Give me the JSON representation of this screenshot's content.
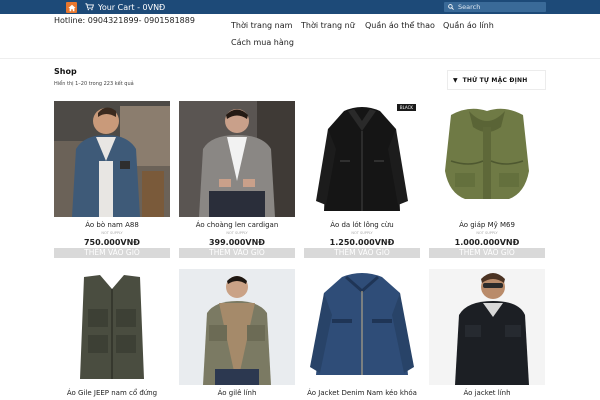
{
  "topbar": {
    "cart_label": "Your Cart - 0VNĐ",
    "search_placeholder": "Search"
  },
  "hotline": "Hotline: 0904321899- 0901581889",
  "nav": {
    "items": [
      {
        "label": "Thời trang nam"
      },
      {
        "label": "Thời trang nữ"
      },
      {
        "label": "Quần áo thể thao"
      },
      {
        "label": "Quần áo lính"
      },
      {
        "label": "Cách mua hàng"
      }
    ]
  },
  "shop": {
    "title": "Shop",
    "result_count": "Hiển thị 1–20 trong 223 kết quả",
    "sort_label": "THỨ TỰ MẶC ĐỊNH"
  },
  "products": [
    {
      "name": "Áo bò nam A88",
      "sku": "NOT SUPPLY",
      "price": "750.000VNĐ",
      "button": "THÊM VÀO GIỎ"
    },
    {
      "name": "Áo choàng len cardigan",
      "sku": "NOT SUPPLY",
      "price": "399.000VNĐ",
      "button": "THÊM VÀO GIỎ"
    },
    {
      "name": "Áo da lót lông cừu",
      "sku": "NOT SUPPLY",
      "price": "1.250.000VNĐ",
      "button": "THÊM VÀO GIỎ",
      "badge": "BLACK"
    },
    {
      "name": "Áo giáp Mỹ M69",
      "sku": "NOT SUPPLY",
      "price": "1.000.000VNĐ",
      "button": "THÊM VÀO GIỎ"
    },
    {
      "name": "Áo Gile JEEP nam cổ đứng"
    },
    {
      "name": "Áo gilê lính"
    },
    {
      "name": "Áo Jacket Denim Nam kéo khóa"
    },
    {
      "name": "Áo jacket lính"
    }
  ],
  "colors": {
    "topbar": "#1d4a78",
    "home_button": "#e8772e",
    "add_to_cart_button": "#d9d9d9"
  },
  "icons": {
    "home": "home-icon",
    "cart": "cart-icon",
    "search": "search-icon",
    "sort": "chevron-down-icon"
  }
}
